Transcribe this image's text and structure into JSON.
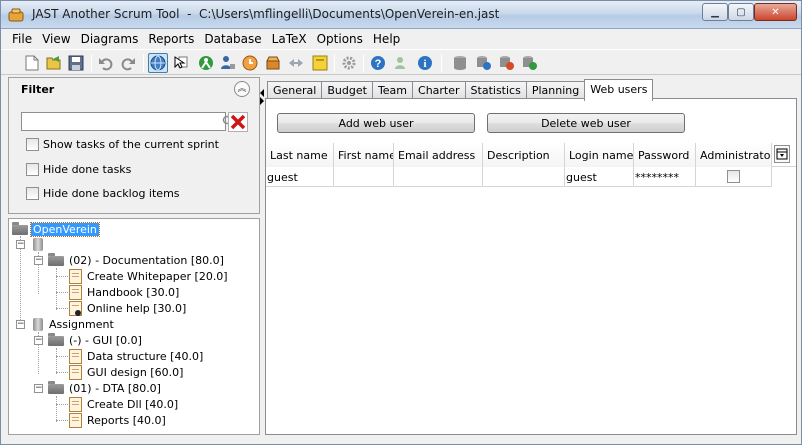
{
  "window": {
    "title": "JAST Another Scrum Tool  -  C:\\Users\\mflingelli\\Documents\\OpenVerein-en.jast",
    "controls": {
      "minimize": "▁",
      "maximize": "▢",
      "close": "✕"
    }
  },
  "menu": [
    "File",
    "View",
    "Diagrams",
    "Reports",
    "Database",
    "LaTeX",
    "Options",
    "Help"
  ],
  "toolbar_icons": [
    "new-file-icon",
    "open-file-icon",
    "save-icon",
    "undo-icon",
    "redo-icon",
    "globe-view-icon",
    "cursor-select-icon",
    "person-icon",
    "person-add-icon",
    "clock-icon",
    "box-icon",
    "arrows-icon",
    "note-icon",
    "settings-gear-icon",
    "help-icon",
    "person-help-icon",
    "info-icon",
    "database-icon",
    "database-globe-icon",
    "database-export-icon",
    "database-user-icon"
  ],
  "filter": {
    "title": "Filter",
    "search_value": "",
    "options": [
      {
        "label": "Show tasks of the current sprint",
        "checked": false
      },
      {
        "label": "Hide done tasks",
        "checked": false
      },
      {
        "label": "Hide done backlog items",
        "checked": false
      }
    ]
  },
  "tree": {
    "root": "OpenVerein",
    "nodes": [
      {
        "label": "",
        "type": "group"
      },
      {
        "label": "(02) - Documentation [80.0]",
        "type": "folder"
      },
      {
        "label": "Create Whitepaper [20.0]",
        "type": "task"
      },
      {
        "label": "Handbook [30.0]",
        "type": "task"
      },
      {
        "label": "Online help [30.0]",
        "type": "task-doing"
      },
      {
        "label": "Assignment",
        "type": "group"
      },
      {
        "label": "(-) - GUI [0.0]",
        "type": "folder"
      },
      {
        "label": "Data structure [40.0]",
        "type": "task"
      },
      {
        "label": "GUI design [60.0]",
        "type": "task"
      },
      {
        "label": "(01) - DTA [80.0]",
        "type": "folder"
      },
      {
        "label": "Create Dll [40.0]",
        "type": "task"
      },
      {
        "label": "Reports [40.0]",
        "type": "task"
      }
    ]
  },
  "tabs": [
    "General",
    "Budget",
    "Team",
    "Charter",
    "Statistics",
    "Planning",
    "Web users"
  ],
  "active_tab": "Web users",
  "web_users": {
    "add_button": "Add web user",
    "delete_button": "Delete web user",
    "columns": [
      "Last name",
      "First name",
      "Email address",
      "Description",
      "Login name",
      "Password",
      "Administrator"
    ],
    "rows": [
      {
        "last_name": "guest",
        "first_name": "",
        "email": "",
        "description": "",
        "login": "guest",
        "password": "********",
        "administrator": false
      }
    ]
  }
}
